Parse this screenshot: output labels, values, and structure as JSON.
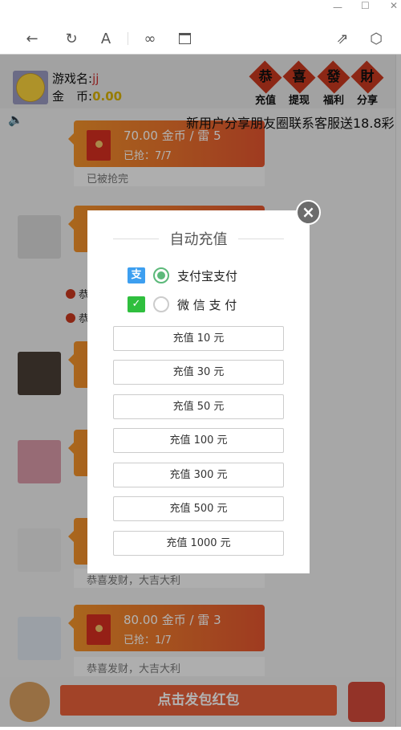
{
  "window": {
    "minimize_icon": "minimize-icon",
    "maximize_icon": "maximize-icon",
    "close_icon": "close-icon"
  },
  "toolbar": {
    "icons": [
      "back-arrow-icon",
      "refresh-icon",
      "font-icon",
      "link-icon",
      "window-icon",
      "share-icon",
      "cube-icon"
    ],
    "font_glyph": "A"
  },
  "header": {
    "name_label": "游戏名:",
    "name_value": "jj",
    "coin_label": "金　币:",
    "coin_value": "0.00",
    "coin_color": "#d9b200",
    "actions": [
      {
        "glyph": "恭",
        "label": "充值"
      },
      {
        "glyph": "喜",
        "label": "提现"
      },
      {
        "glyph": "發",
        "label": "福利"
      },
      {
        "glyph": "財",
        "label": "分享"
      }
    ]
  },
  "marquee": {
    "text": "新用户分享朋友圈联系客服送18.8彩"
  },
  "messages": [
    {
      "amount": "70.00 金币 / 雷 5",
      "grabbed": "已抢：7/7",
      "footer": "已被抢完"
    },
    {
      "amount": "80.00 金币 / 雷 3",
      "grabbed": "已抢：1/7",
      "footer": "恭喜发财，大吉大利"
    }
  ],
  "partial_footer": "恭喜发财，大吉大利",
  "notices": [
    "恭",
    "恭"
  ],
  "bottom": {
    "send_label": "点击发包红包"
  },
  "modal": {
    "title": "自动充值",
    "payments": [
      {
        "icon": "alipay-icon",
        "glyph": "支",
        "label": "支付宝支付",
        "selected": true,
        "color": "#3d9ff0"
      },
      {
        "icon": "wechat-icon",
        "glyph": "✓",
        "label": "微 信 支 付",
        "selected": false,
        "color": "#2fbf3e"
      }
    ],
    "amounts": [
      "充值 10 元",
      "充值 30 元",
      "充值 50 元",
      "充值 100 元",
      "充值 300 元",
      "充值 500 元",
      "充值 1000 元"
    ],
    "close_glyph": "×"
  }
}
